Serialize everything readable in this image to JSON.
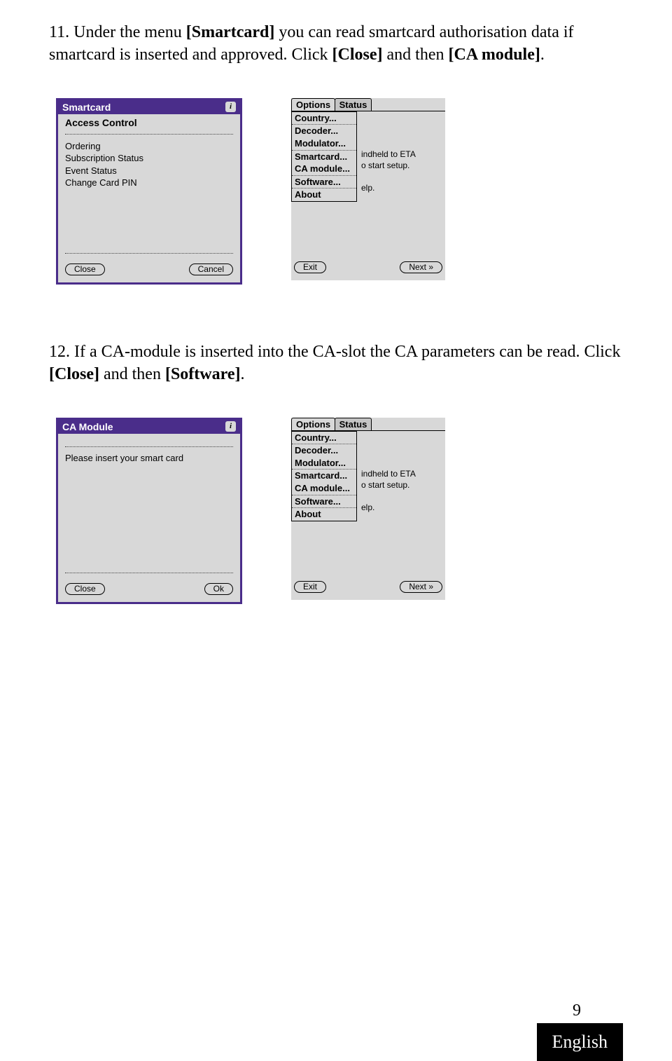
{
  "instruction11": {
    "prefix": "11. Under the menu ",
    "smartcard": "[Smartcard]",
    "mid1": " you can read smartcard authorisation data if smartcard is inserted and approved. Click ",
    "close": "[Close]",
    "mid2": " and then ",
    "camod": "[CA module]",
    "suffix": "."
  },
  "instruction12": {
    "prefix": "12. If a CA-module is inserted into the CA-slot the CA parameters can be read. Click ",
    "close": "[Close]",
    "mid": " and then ",
    "software": "[Software]",
    "suffix": "."
  },
  "dialog1": {
    "title": "Smartcard",
    "heading": "Access Control",
    "items": [
      "Ordering",
      "Subscription Status",
      "Event Status",
      "Change Card PIN"
    ],
    "btn_left": "Close",
    "btn_right": "Cancel"
  },
  "dialog2": {
    "title": "CA Module",
    "message": "Please insert your smart card",
    "btn_left": "Close",
    "btn_right": "Ok"
  },
  "options": {
    "tab1": "Options",
    "tab2": "Status",
    "items": [
      "Country...",
      "Decoder...",
      "Modulator...",
      "Smartcard...",
      "CA module...",
      "Software...",
      "About"
    ],
    "side1": "indheld to ETA",
    "side2": "o start setup.",
    "side3": "elp.",
    "btn_left": "Exit",
    "btn_right": "Next »"
  },
  "footer": {
    "page": "9",
    "lang": "English"
  }
}
